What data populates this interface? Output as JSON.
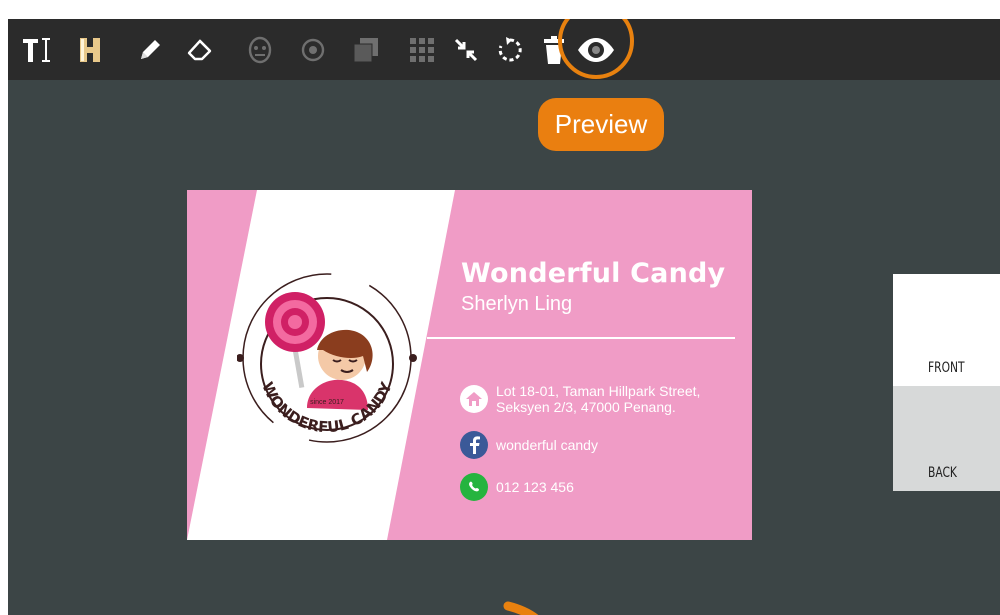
{
  "toolbar": {
    "tools": [
      {
        "icon": "text-tool-icon"
      },
      {
        "icon": "heading-tool-icon"
      },
      {
        "icon": "pencil-icon"
      },
      {
        "icon": "eraser-icon"
      },
      {
        "icon": "face-mask-icon"
      },
      {
        "icon": "flower-icon"
      },
      {
        "icon": "layers-icon"
      },
      {
        "icon": "grid-icon"
      },
      {
        "icon": "shrink-arrows-icon"
      },
      {
        "icon": "rotate-icon"
      },
      {
        "icon": "trash-icon"
      },
      {
        "icon": "eye-icon"
      }
    ]
  },
  "tooltip": {
    "label": "Preview",
    "color": "#ea7f10"
  },
  "card": {
    "company": "Wonderful Candy",
    "person": "Sherlyn Ling",
    "address_line1": "Lot 18-01, Taman Hillpark Street,",
    "address_line2": "Seksyen 2/3, 47000 Penang.",
    "facebook": "wonderful candy",
    "phone": "012 123 456",
    "logo_text": "WONDERFUL CANDY",
    "logo_since": "since 2017",
    "bg_color": "#f09cc6"
  },
  "sides": {
    "front": "FRONT",
    "back": "BACK"
  },
  "colors": {
    "accent": "#e8810f",
    "canvas": "#3c4546",
    "toolbar": "#2b2b2b"
  }
}
